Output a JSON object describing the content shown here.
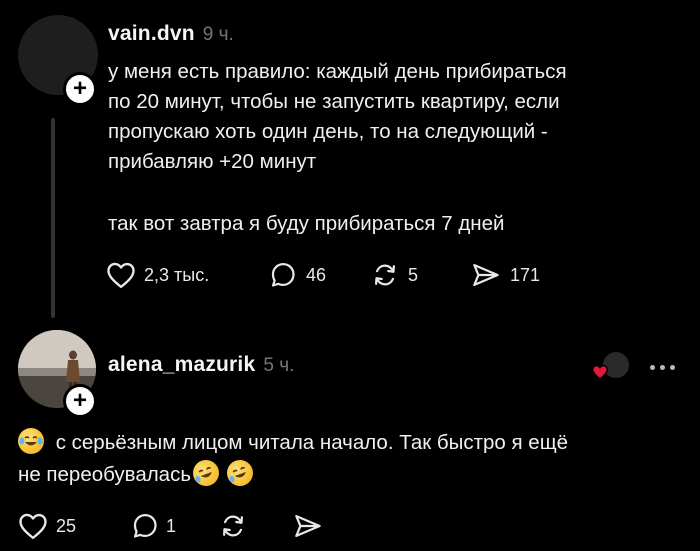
{
  "posts": [
    {
      "username": "vain.dvn",
      "time": "9 ч.",
      "text": "у меня есть правило: каждый день прибираться\nпо 20 минут, чтобы не запустить квартиру, если\nпропускаю хоть один день, то на следующий -\nприбавляю +20 минут",
      "text2": "так вот завтра я буду прибираться 7 дней",
      "likes": "2,3 тыс.",
      "comments": "46",
      "reposts": "5",
      "shares": "171"
    },
    {
      "username": "alena_mazurik",
      "time": "5 ч.",
      "text_line1": "с серьёзным лицом читала начало. Так быстро я ещё",
      "text_line2": "не переобувалась",
      "likes": "25",
      "comments": "1",
      "emoji": [
        "joy-tears-emoji",
        "rofl-emoji",
        "rofl-emoji"
      ]
    }
  ],
  "colors": {
    "background": "#000000",
    "text": "#f0f0f0",
    "muted": "#777777",
    "heart": "#e0193a"
  }
}
